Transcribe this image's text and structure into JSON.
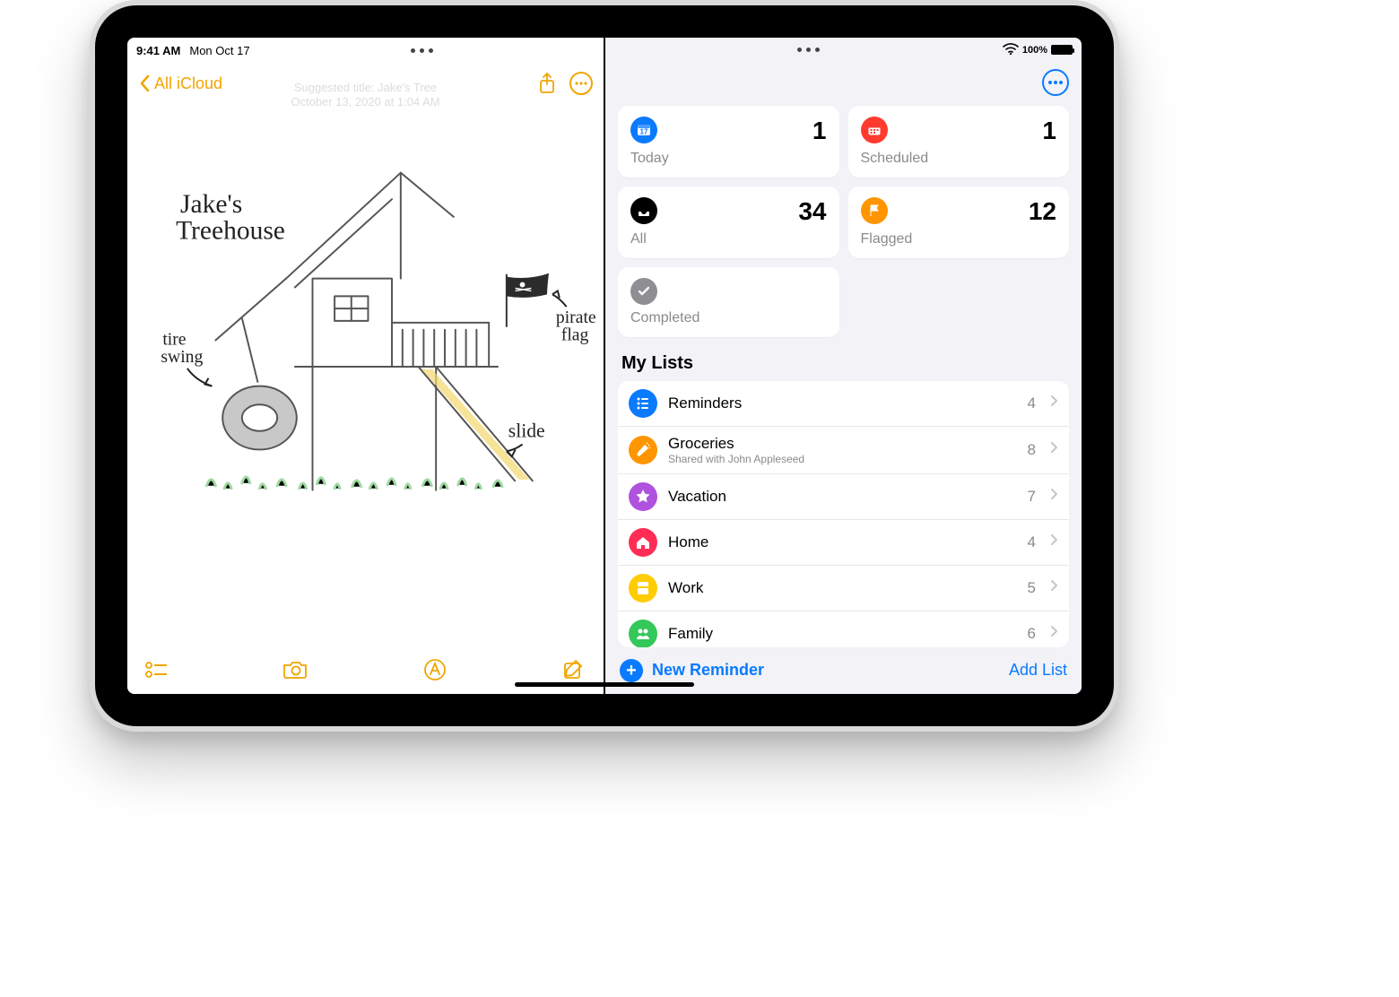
{
  "status": {
    "time": "9:41 AM",
    "date": "Mon Oct 17",
    "battery": "100%"
  },
  "notes": {
    "back_label": "All iCloud",
    "suggest_line1": "Suggested title: Jake's Tree",
    "suggest_line2": "October 13, 2020 at 1:04 AM",
    "sketch": {
      "title": "Jake's Treehouse",
      "label_swing": "tire swing",
      "label_flag": "pirate flag",
      "label_slide": "slide"
    }
  },
  "reminders": {
    "cards": {
      "today": {
        "title": "Today",
        "count": "1"
      },
      "scheduled": {
        "title": "Scheduled",
        "count": "1"
      },
      "all": {
        "title": "All",
        "count": "34"
      },
      "flagged": {
        "title": "Flagged",
        "count": "12"
      },
      "completed": {
        "title": "Completed",
        "count": ""
      }
    },
    "section_title": "My Lists",
    "lists": [
      {
        "name": "Reminders",
        "subtitle": "",
        "count": "4",
        "color": "bg-blue",
        "icon": "list"
      },
      {
        "name": "Groceries",
        "subtitle": "Shared with John Appleseed",
        "count": "8",
        "color": "bg-orange",
        "icon": "carrot"
      },
      {
        "name": "Vacation",
        "subtitle": "",
        "count": "7",
        "color": "bg-purple",
        "icon": "star"
      },
      {
        "name": "Home",
        "subtitle": "",
        "count": "4",
        "color": "bg-pink",
        "icon": "house"
      },
      {
        "name": "Work",
        "subtitle": "",
        "count": "5",
        "color": "bg-yellow",
        "icon": "book"
      },
      {
        "name": "Family",
        "subtitle": "",
        "count": "6",
        "color": "bg-green",
        "icon": "people"
      }
    ],
    "new_reminder_label": "New Reminder",
    "add_list_label": "Add List"
  }
}
